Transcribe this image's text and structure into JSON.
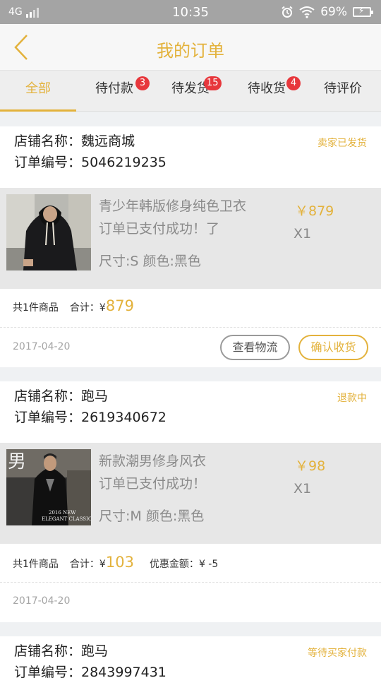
{
  "status_bar": {
    "network": "4G",
    "time": "10:35",
    "battery": "69%"
  },
  "header": {
    "title": "我的订单"
  },
  "tabs": [
    {
      "label": "全部",
      "badge": ""
    },
    {
      "label": "待付款",
      "badge": "3"
    },
    {
      "label": "待发货",
      "badge": "15"
    },
    {
      "label": "待收货",
      "badge": "4"
    },
    {
      "label": "待评价",
      "badge": ""
    }
  ],
  "orders": [
    {
      "shop": "店铺名称：魏远商城",
      "order_no": "订单编号：5046219235",
      "status": "卖家已发货",
      "product": {
        "name": "青少年韩版修身纯色卫衣",
        "desc": "订单已支付成功！了",
        "spec": "尺寸:S 颜色:黑色",
        "price": "￥879",
        "qty": "X1"
      },
      "summary": {
        "count": "共1件商品",
        "total_label": "合计：¥",
        "total": "879",
        "discount_label": "",
        "discount": ""
      },
      "date": "2017-04-20",
      "buttons": [
        "查看物流",
        "确认收货"
      ]
    },
    {
      "shop": "店铺名称：跑马",
      "order_no": "订单编号：2619340672",
      "status": "退款中",
      "product": {
        "name": "新款潮男修身风衣",
        "desc": "订单已支付成功！",
        "spec": "尺寸:M 颜色:黑色",
        "price": "￥98",
        "qty": "X1",
        "image_text": {
          "big": "男",
          "line1": "2016 NEW",
          "line2": "ELEGANT CLASSIC"
        }
      },
      "summary": {
        "count": "共1件商品",
        "total_label": "合计：¥",
        "total": "103",
        "discount_label": "优惠金额：",
        "discount": "¥ -5"
      },
      "date": "2017-04-20",
      "buttons": []
    },
    {
      "shop": "店铺名称：跑马",
      "order_no": "订单编号：2843997431",
      "status": "等待买家付款"
    }
  ]
}
